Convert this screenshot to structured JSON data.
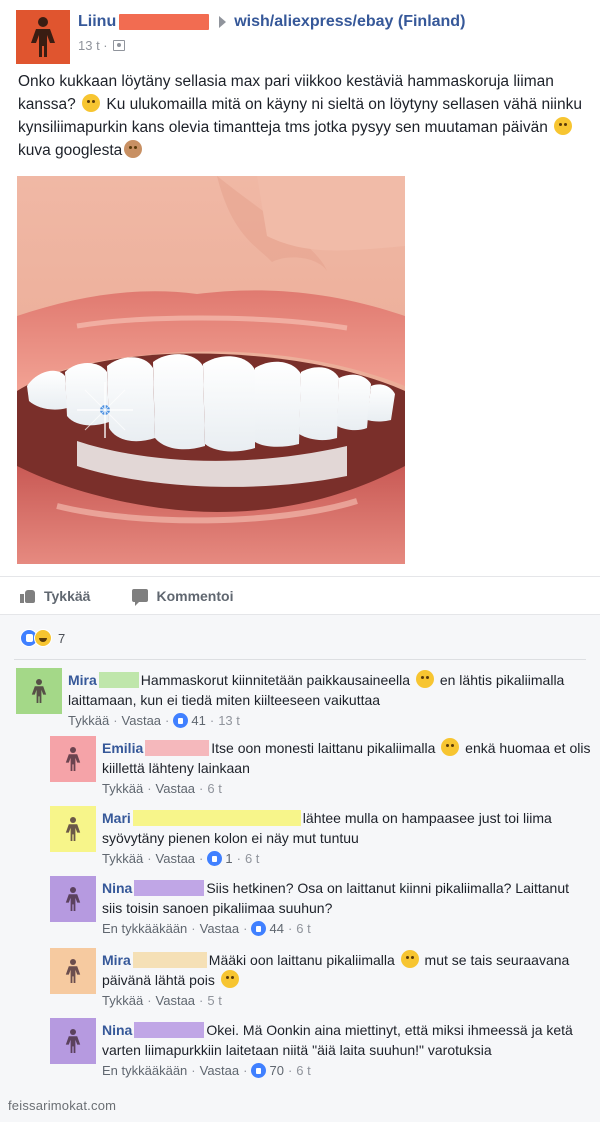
{
  "post": {
    "author": "Liinu",
    "group": "wish/aliexpress/ebay (Finland)",
    "time": "13 t ·",
    "text_1": "Onko kukkaan löytäny sellasia max pari viikkoo kestäviä hammaskoruja liiman kanssa? ",
    "text_2": " Ku ulukomailla mitä on käyny ni sieltä on löytyny sellasen vähä niinku kynsiliimapurkin kans olevia timantteja tms jotka pysyy sen muutaman päivän ",
    "text_3": " kuva googlesta",
    "colors": {
      "avatar": "#e0552f",
      "redaction": "#f26c51"
    }
  },
  "actions": {
    "like": "Tykkää",
    "comment": "Kommentoi"
  },
  "reactions": {
    "count": "7"
  },
  "comments": [
    {
      "name": "Mira",
      "text": "Hammaskorut kiinnitetään paikkausaineella ",
      "text_after": " en lähtis pikaliimalla laittamaan, kun ei tiedä miten kiilteeseen vaikuttaa",
      "action1": "Tykkää",
      "action2": "Vastaa",
      "likes": "41",
      "time": "13 t",
      "avatar_color": "#a4d888",
      "redact_color": "#bfe6ab"
    },
    {
      "name": "Emilia",
      "text": "Itse oon monesti laittanu pikaliimalla ",
      "text_after": " enkä huomaa et olis kiillettä lähteny lainkaan",
      "action1": "Tykkää",
      "action2": "Vastaa",
      "likes": "",
      "time": "6 t",
      "avatar_color": "#f5a3a8",
      "redact_color": "#f5b8bc"
    },
    {
      "name": "Mari",
      "text": "lähtee mulla on hampaasee just toi liima syövytäny pienen kolon ei näy mut tuntuu",
      "text_after": "",
      "action1": "Tykkää",
      "action2": "Vastaa",
      "likes": "1",
      "time": "6 t",
      "avatar_color": "#f7f58a",
      "redact_color": "#f7f58a"
    },
    {
      "name": "Nina",
      "text": "Siis hetkinen? Osa on laittanut kiinni pikaliimalla? Laittanut siis toisin sanoen pikaliimaa suuhun?",
      "text_after": "",
      "action1": "En tykkääkään",
      "action2": "Vastaa",
      "likes": "44",
      "time": "6 t",
      "avatar_color": "#b69ae0",
      "redact_color": "#c0a6e6"
    },
    {
      "name": "Mira",
      "text": "Määki oon laittanu pikaliimalla ",
      "text_after": " mut se tais seuraavana päivänä lähtä pois ",
      "action1": "Tykkää",
      "action2": "Vastaa",
      "likes": "",
      "time": "5 t",
      "avatar_color": "#f6caa0",
      "redact_color": "#f5e0b6"
    },
    {
      "name": "Nina",
      "text": "Okei. Mä Oonkin aina miettinyt, että miksi ihmeessä ja ketä varten liimapurkkiin laitetaan niitä \"äiä laita suuhun!\" varotuksia",
      "text_after": "",
      "action1": "En tykkääkään",
      "action2": "Vastaa",
      "likes": "70",
      "time": "6 t",
      "avatar_color": "#b69ae0",
      "redact_color": "#c0a6e6"
    }
  ],
  "watermark": "feissarimokat.com",
  "icons": [
    "person-silhouette-icon",
    "triangle-right-icon",
    "audience-icon",
    "thumbs-up-icon",
    "comment-bubble-icon",
    "like-reaction-icon",
    "haha-reaction-icon",
    "smiley-emoji-icon"
  ]
}
